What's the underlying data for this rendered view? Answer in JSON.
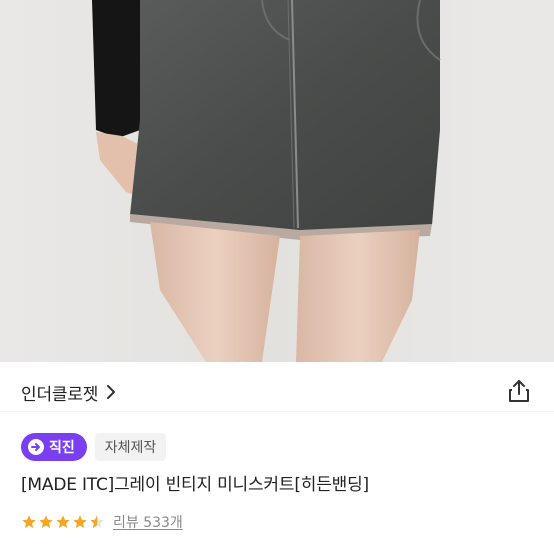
{
  "product_image": {
    "alt": "",
    "colors": {
      "skirt": "#4d4f4e",
      "wall": "#e6e4e2",
      "skin": "#e4c7b6",
      "top": "#141414"
    }
  },
  "brand": {
    "name": "인더클로젯",
    "chevron_icon": "chevron-right-icon"
  },
  "share": {
    "icon": "share-icon"
  },
  "tags": {
    "direct": "직진",
    "direct_icon": "arrow-right-circle-icon",
    "self_made": "자체제작",
    "accent": "#7b3ff2"
  },
  "product": {
    "title": "[MADE ITC]그레이 빈티지 미니스커트[히든밴딩]"
  },
  "rating": {
    "stars": 4.5,
    "star_color": "#f5a623",
    "review_label": "리뷰 533개"
  }
}
